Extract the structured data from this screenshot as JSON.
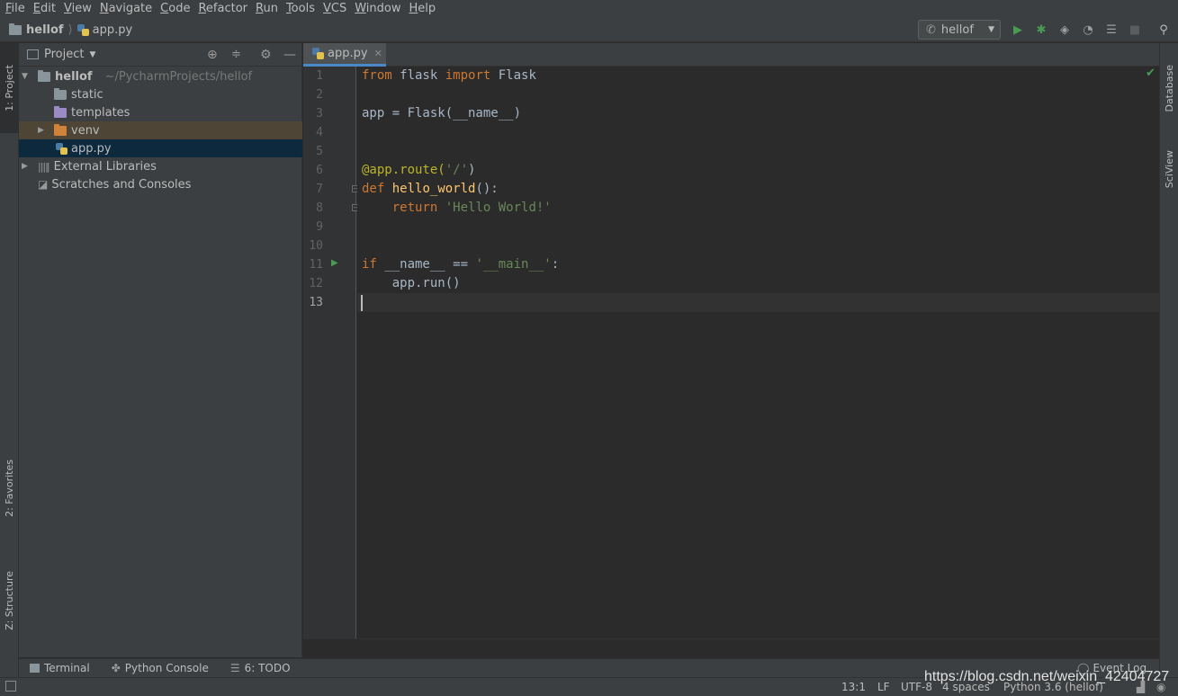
{
  "menu": [
    "File",
    "Edit",
    "View",
    "Navigate",
    "Code",
    "Refactor",
    "Run",
    "Tools",
    "VCS",
    "Window",
    "Help"
  ],
  "breadcrumb": {
    "project": "hellof",
    "file": "app.py"
  },
  "run_config": {
    "label": "hellof"
  },
  "left_tabs": {
    "project": "1: Project",
    "favorites": "2: Favorites",
    "structure": "Z: Structure"
  },
  "right_tabs": {
    "database": "Database",
    "sciview": "SciView"
  },
  "project_panel": {
    "title": "Project",
    "tree": [
      {
        "label": "hellof",
        "path": "~/PycharmProjects/hellof"
      },
      {
        "label": "static"
      },
      {
        "label": "templates"
      },
      {
        "label": "venv"
      },
      {
        "label": "app.py"
      },
      {
        "label": "External Libraries"
      },
      {
        "label": "Scratches and Consoles"
      }
    ]
  },
  "editor": {
    "tab": "app.py",
    "line_numbers": [
      "1",
      "2",
      "3",
      "4",
      "5",
      "6",
      "7",
      "8",
      "9",
      "10",
      "11",
      "12",
      "13"
    ],
    "lines": {
      "l1": {
        "a": "from",
        "b": " flask ",
        "c": "import",
        "d": " Flask"
      },
      "l3": "app = Flask(__name__)",
      "l6": {
        "a": "@app.route(",
        "b": "'/'",
        "c": ")"
      },
      "l7": {
        "a": "def",
        "b": " ",
        "c": "hello_world",
        "d": "():"
      },
      "l8": {
        "a": "    ",
        "b": "return",
        "c": " ",
        "d": "'Hello World!'"
      },
      "l11": {
        "a": "if",
        "b": " __name__ == ",
        "c": "'__main__'",
        "d": ":"
      },
      "l12": "    app.run()"
    }
  },
  "bottom_tools": {
    "terminal": "Terminal",
    "python_console": "Python Console",
    "todo": "6: TODO",
    "event_log": "Event Log"
  },
  "status": {
    "position": "13:1",
    "line_sep": "LF",
    "encoding": "UTF-8",
    "indent": "4 spaces",
    "interpreter": "Python 3.6 (hellof)"
  },
  "watermark": "https://blog.csdn.net/weixin_42404727"
}
